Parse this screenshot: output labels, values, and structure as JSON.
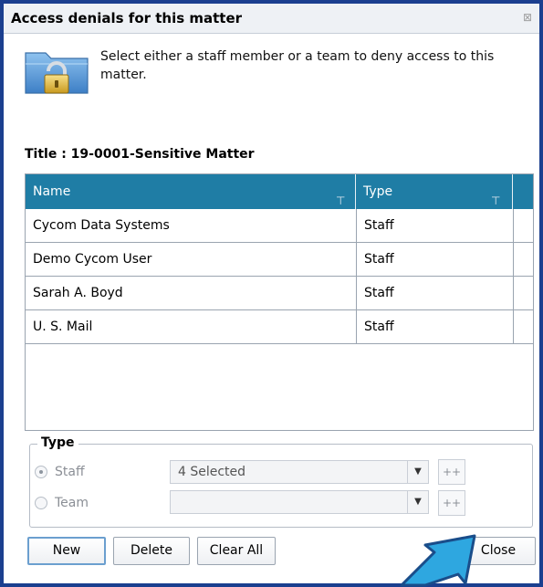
{
  "dialog": {
    "title": "Access denials for this matter",
    "close_glyph": "⊠",
    "instruction": "Select either a staff member or a team to deny access to this matter.",
    "icon": "folder-lock-icon"
  },
  "matter": {
    "title_label": "Title : 19-0001-Sensitive Matter"
  },
  "grid": {
    "columns": [
      "Name",
      "Type"
    ],
    "filter_glyph": "⊤",
    "rows": [
      {
        "name": "Cycom Data Systems",
        "type": "Staff"
      },
      {
        "name": "Demo Cycom User",
        "type": "Staff"
      },
      {
        "name": "Sarah A. Boyd",
        "type": "Staff"
      },
      {
        "name": "U. S. Mail",
        "type": "Staff"
      }
    ]
  },
  "type_group": {
    "legend": "Type",
    "staff_label": "Staff",
    "team_label": "Team",
    "selected": "Staff",
    "staff_value": "4 Selected",
    "team_value": "",
    "add_label": "++"
  },
  "buttons": {
    "new": "New",
    "delete": "Delete",
    "clear_all": "Clear All",
    "close": "Close"
  },
  "colors": {
    "header_bg": "#1f7da5",
    "frame": "#1b3f8f",
    "arrow": "#2ea7e0"
  }
}
